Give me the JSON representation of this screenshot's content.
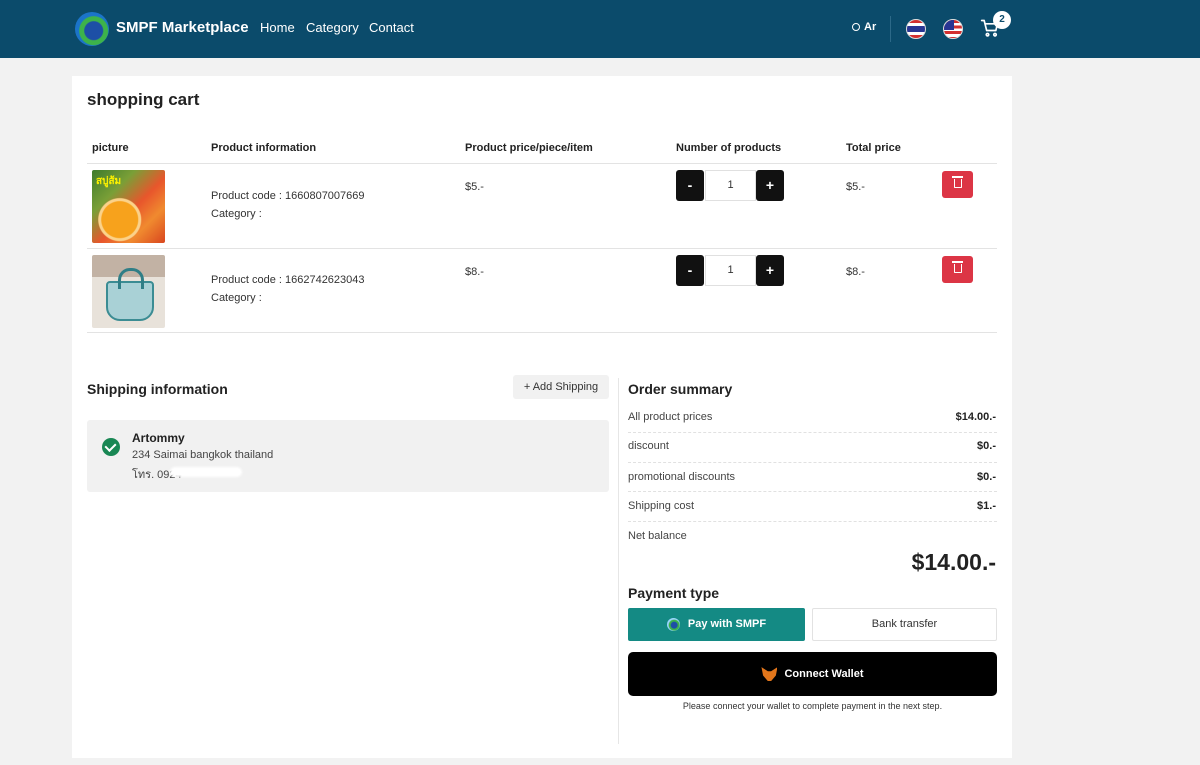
{
  "navbar": {
    "brand": "SMPF Marketplace",
    "links": [
      "Home",
      "Category",
      "Contact"
    ],
    "user_label": "Ar",
    "cart_count": "2"
  },
  "cart": {
    "title": "shopping cart",
    "headers": {
      "picture": "picture",
      "info": "Product information",
      "price": "Product price/piece/item",
      "qty": "Number of products",
      "total": "Total price"
    },
    "rows": [
      {
        "code": "Product code : 1660807007669",
        "category": "Category :",
        "price": "$5.-",
        "qty": "1",
        "total": "$5.-"
      },
      {
        "code": "Product code : 1662742623043",
        "category": "Category :",
        "price": "$8.-",
        "qty": "1",
        "total": "$8.-"
      }
    ],
    "minus_label": "-",
    "plus_label": "+"
  },
  "shipping": {
    "title": "Shipping information",
    "add_label": "+ Add Shipping",
    "name": "Artommy",
    "address": "234 Saimai bangkok thailand",
    "phone": "โทร. 0924"
  },
  "summary": {
    "title": "Order summary",
    "rows": [
      {
        "label": "All product prices",
        "value": "$14.00.-"
      },
      {
        "label": "discount",
        "value": "$0.-"
      },
      {
        "label": "promotional discounts",
        "value": "$0.-"
      },
      {
        "label": "Shipping cost",
        "value": "$1.-"
      }
    ],
    "net_label": "Net balance",
    "net_value": "$14.00.-",
    "payment_title": "Payment type",
    "pay_smpf": "Pay with SMPF",
    "pay_bank": "Bank transfer",
    "connect": "Connect Wallet",
    "connect_note": "Please connect your wallet to complete payment in the next step."
  },
  "colors": {
    "navbar": "#0b4b6b",
    "teal_button": "#148a84",
    "delete_button": "#dc3545",
    "check": "#198754"
  }
}
